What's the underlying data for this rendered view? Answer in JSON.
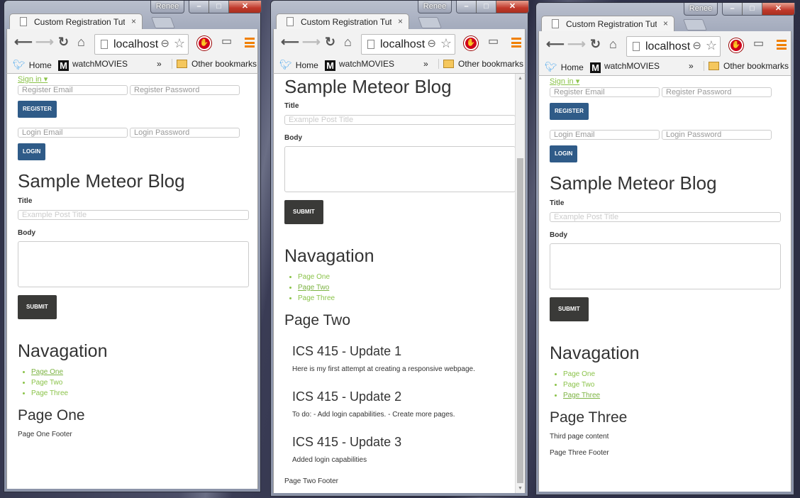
{
  "chrome": {
    "profile": "Renee",
    "tab_title": "Custom Registration Tutorial",
    "tab_close": "×",
    "url": "localhost",
    "bookmarks": [
      "Home",
      "watchMOVIES"
    ],
    "overflow": "»",
    "other_bookmarks": "Other bookmarks",
    "minimize": "–",
    "maximize": "□",
    "close": "✕"
  },
  "form": {
    "sign_in": "Sign in ▾",
    "register_email_placeholder": "Register Email",
    "register_password_placeholder": "Register Password",
    "register_button": "REGISTER",
    "login_email_placeholder": "Login Email",
    "login_password_placeholder": "Login Password",
    "login_button": "LOGIN"
  },
  "blog": {
    "title": "Sample Meteor Blog",
    "title_label": "Title",
    "title_placeholder": "Example Post Title",
    "body_label": "Body",
    "submit": "SUBMIT",
    "nav_heading": "Navagation",
    "nav_items": [
      "Page One",
      "Page Two",
      "Page Three"
    ]
  },
  "windows": [
    {
      "page_heading": "Page One",
      "active_nav": 0,
      "show_login": true,
      "footer": "Page One Footer"
    },
    {
      "page_heading": "Page Two",
      "active_nav": 1,
      "show_login": false,
      "footer": "Page Two Footer",
      "updates": [
        {
          "title": "ICS 415 - Update 1",
          "body": "Here is my first attempt at creating a responsive webpage."
        },
        {
          "title": "ICS 415 - Update 2",
          "body": "To do: - Add login capabilities. - Create more pages."
        },
        {
          "title": "ICS 415 - Update 3",
          "body": "Added login capabilities"
        }
      ]
    },
    {
      "page_heading": "Page Three",
      "active_nav": 2,
      "show_login": true,
      "content": "Third page content",
      "footer": "Page Three Footer"
    }
  ]
}
